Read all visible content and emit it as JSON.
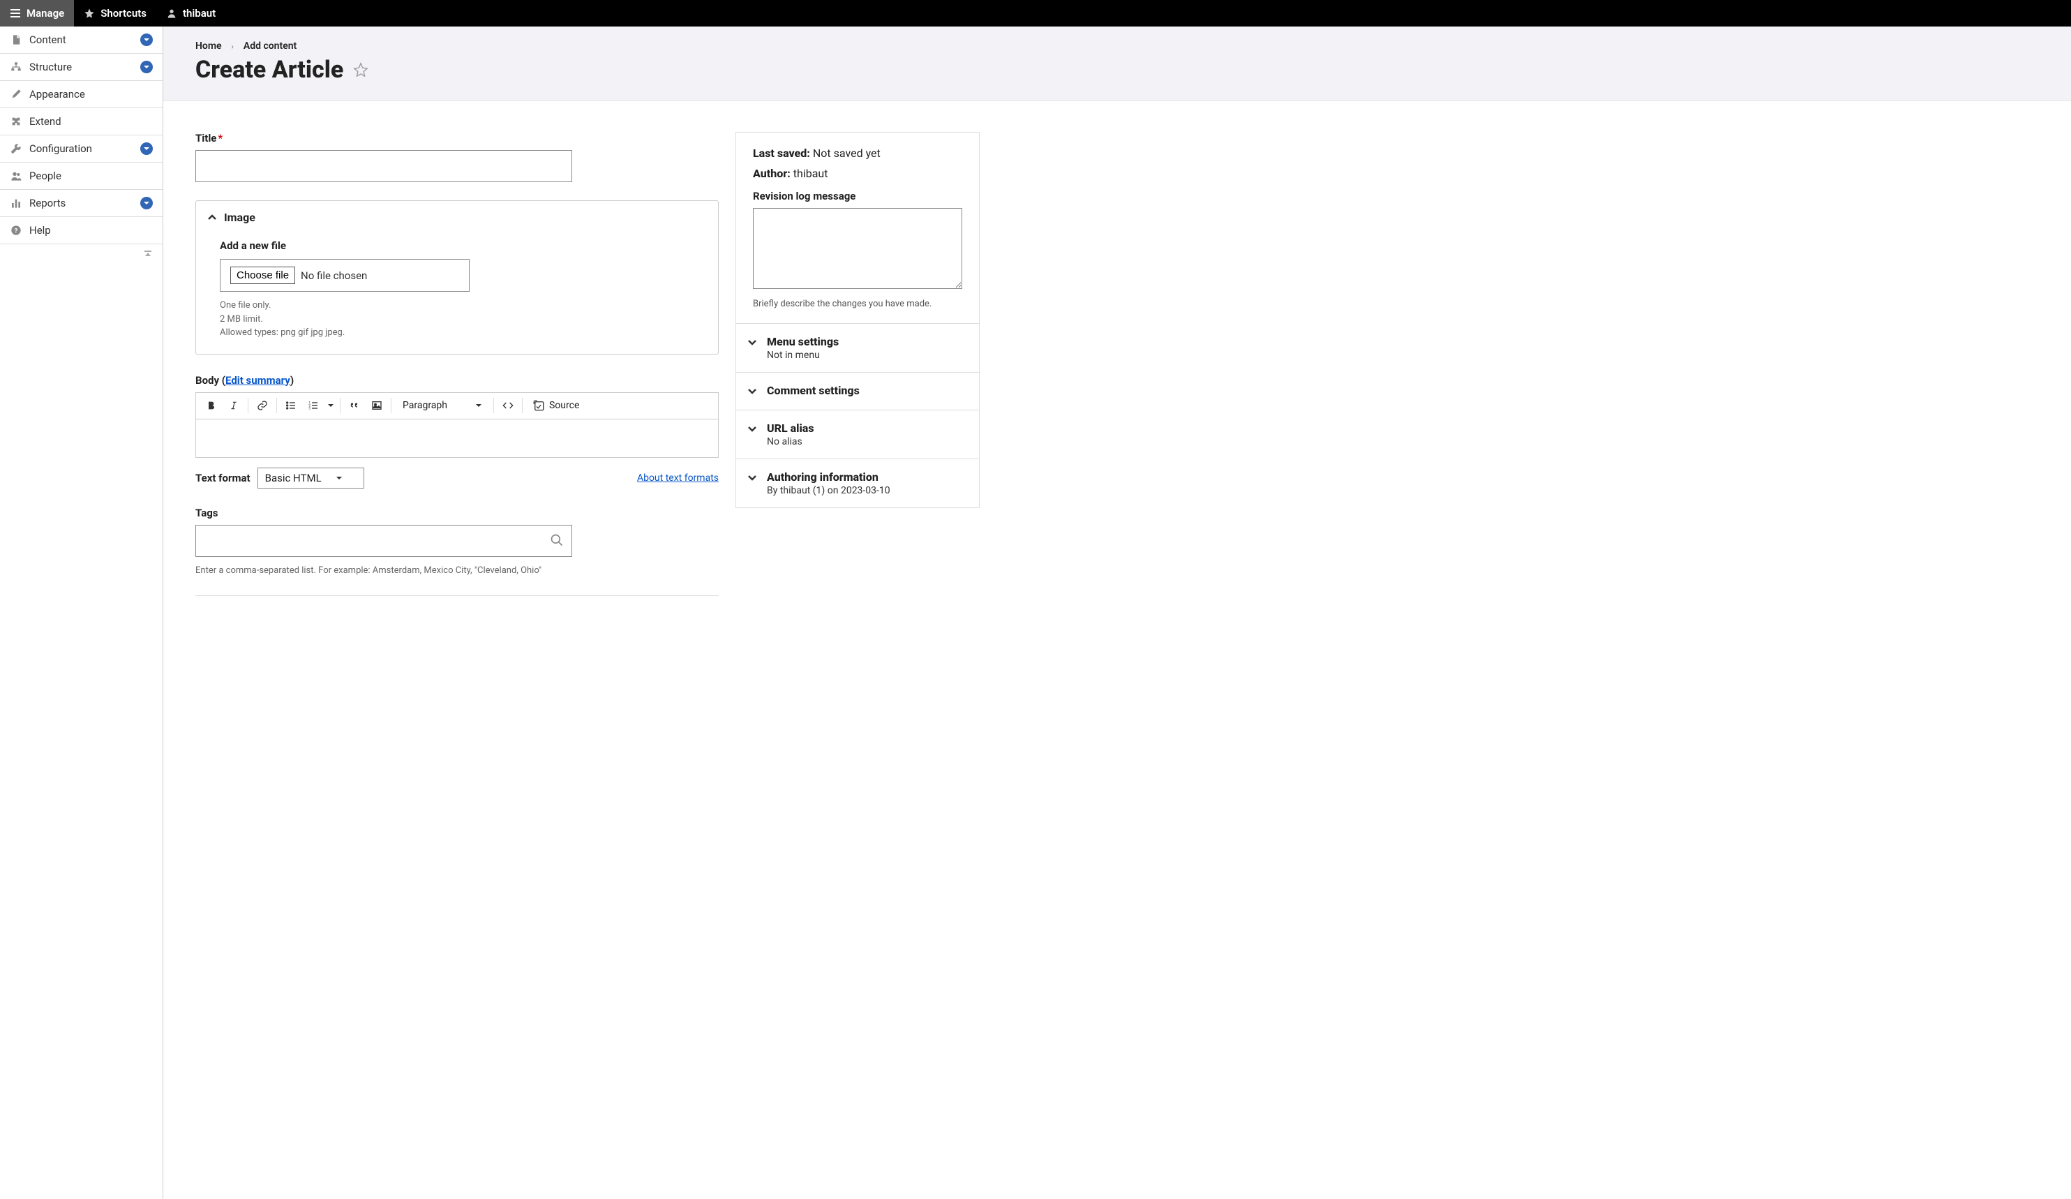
{
  "toolbar": {
    "manage": "Manage",
    "shortcuts": "Shortcuts",
    "user": "thibaut"
  },
  "sidebar": {
    "items": [
      {
        "label": "Content",
        "expandable": true
      },
      {
        "label": "Structure",
        "expandable": true
      },
      {
        "label": "Appearance",
        "expandable": false
      },
      {
        "label": "Extend",
        "expandable": false
      },
      {
        "label": "Configuration",
        "expandable": true
      },
      {
        "label": "People",
        "expandable": false
      },
      {
        "label": "Reports",
        "expandable": true
      },
      {
        "label": "Help",
        "expandable": false
      }
    ]
  },
  "breadcrumb": {
    "home": "Home",
    "add_content": "Add content"
  },
  "page": {
    "title": "Create Article"
  },
  "form": {
    "title_label": "Title",
    "image_section": "Image",
    "add_file_label": "Add a new file",
    "choose_file_btn": "Choose file",
    "no_file_chosen": "No file chosen",
    "file_help_1": "One file only.",
    "file_help_2": "2 MB limit.",
    "file_help_3": "Allowed types: png gif jpg jpeg.",
    "body_label_pre": "Body (",
    "edit_summary": "Edit summary",
    "body_label_post": ")",
    "paragraph_option": "Paragraph",
    "source_label": "Source",
    "text_format_label": "Text format",
    "text_format_value": "Basic HTML",
    "about_formats": "About text formats",
    "tags_label": "Tags",
    "tags_help": "Enter a comma-separated list. For example: Amsterdam, Mexico City, \"Cleveland, Ohio\""
  },
  "aside": {
    "last_saved_label": "Last saved:",
    "last_saved_value": "Not saved yet",
    "author_label": "Author:",
    "author_value": "thibaut",
    "revision_label": "Revision log message",
    "revision_help": "Briefly describe the changes you have made.",
    "accordions": [
      {
        "title": "Menu settings",
        "sub": "Not in menu"
      },
      {
        "title": "Comment settings",
        "sub": ""
      },
      {
        "title": "URL alias",
        "sub": "No alias"
      },
      {
        "title": "Authoring information",
        "sub": "By thibaut (1) on 2023-03-10"
      }
    ]
  }
}
